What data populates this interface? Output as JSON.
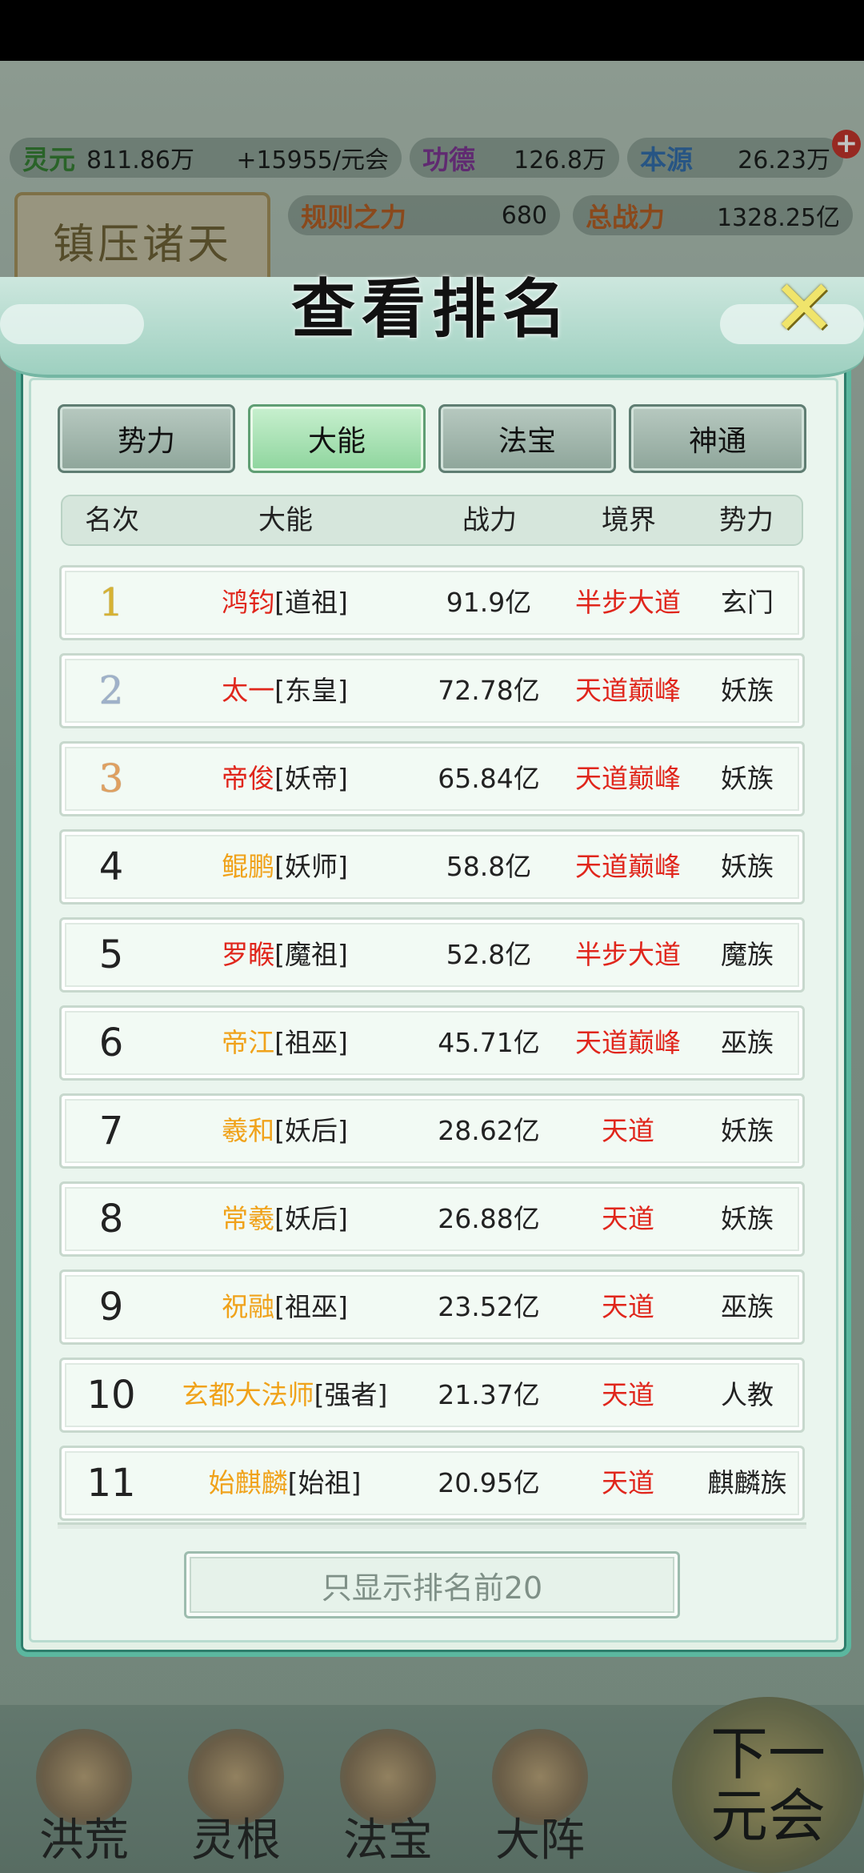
{
  "hud": {
    "lingyuan_label": "灵元",
    "lingyuan_value": "811.86万",
    "lingyuan_rate": "+15955/元会",
    "gongde_label": "功德",
    "gongde_value": "126.8万",
    "benyuan_label": "本源",
    "benyuan_value": "26.23万",
    "guize_label": "规则之力",
    "guize_value": "680",
    "zongzhanli_label": "总战力",
    "zongzhanli_value": "1328.25亿",
    "banner_text": "镇压诸天"
  },
  "modal": {
    "title": "查看排名",
    "close_icon": "close-icon",
    "tabs": [
      {
        "label": "势力",
        "active": false
      },
      {
        "label": "大能",
        "active": true
      },
      {
        "label": "法宝",
        "active": false
      },
      {
        "label": "神通",
        "active": false
      }
    ],
    "columns": [
      "名次",
      "大能",
      "战力",
      "境界",
      "势力"
    ],
    "rows": [
      {
        "rank": "1",
        "name": "鸿钧",
        "title": "[道祖]",
        "power": "91.9亿",
        "realm": "半步大道",
        "faction": "玄门"
      },
      {
        "rank": "2",
        "name": "太一",
        "title": "[东皇]",
        "power": "72.78亿",
        "realm": "天道巅峰",
        "faction": "妖族"
      },
      {
        "rank": "3",
        "name": "帝俊",
        "title": "[妖帝]",
        "power": "65.84亿",
        "realm": "天道巅峰",
        "faction": "妖族"
      },
      {
        "rank": "4",
        "name": "鲲鹏",
        "title": "[妖师]",
        "power": "58.8亿",
        "realm": "天道巅峰",
        "faction": "妖族"
      },
      {
        "rank": "5",
        "name": "罗睺",
        "title": "[魔祖]",
        "power": "52.8亿",
        "realm": "半步大道",
        "faction": "魔族"
      },
      {
        "rank": "6",
        "name": "帝江",
        "title": "[祖巫]",
        "power": "45.71亿",
        "realm": "天道巅峰",
        "faction": "巫族"
      },
      {
        "rank": "7",
        "name": "羲和",
        "title": "[妖后]",
        "power": "28.62亿",
        "realm": "天道",
        "faction": "妖族"
      },
      {
        "rank": "8",
        "name": "常羲",
        "title": "[妖后]",
        "power": "26.88亿",
        "realm": "天道",
        "faction": "妖族"
      },
      {
        "rank": "9",
        "name": "祝融",
        "title": "[祖巫]",
        "power": "23.52亿",
        "realm": "天道",
        "faction": "巫族"
      },
      {
        "rank": "10",
        "name": "玄都大法师",
        "title": "[强者]",
        "power": "21.37亿",
        "realm": "天道",
        "faction": "人教"
      },
      {
        "rank": "11",
        "name": "始麒麟",
        "title": "[始祖]",
        "power": "20.95亿",
        "realm": "天道",
        "faction": "麒麟族"
      }
    ],
    "filter_button": "只显示排名前20"
  },
  "nav": {
    "items": [
      "洪荒",
      "灵根",
      "法宝",
      "大阵"
    ],
    "next_line1": "下一",
    "next_line2": "元会"
  },
  "colors": {
    "accent": "#5bb79f",
    "name_red": "#e0261c",
    "name_orange": "#f0a21a",
    "realm_red": "#e0261c"
  }
}
